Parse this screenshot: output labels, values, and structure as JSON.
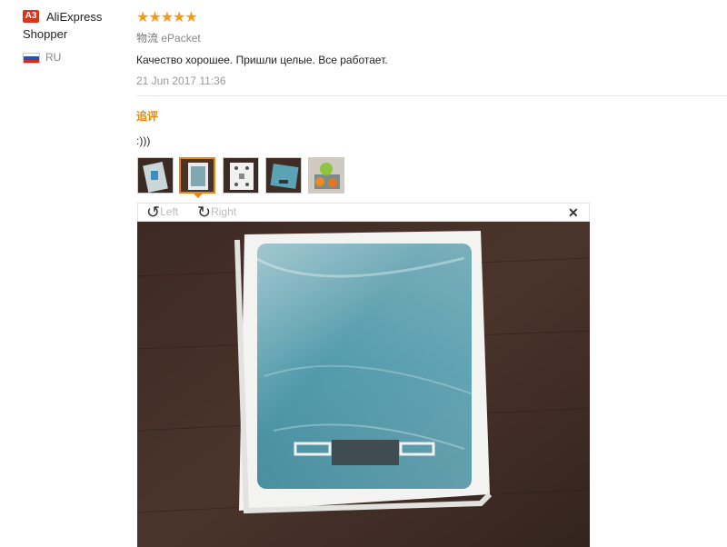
{
  "reviewer": {
    "badge": "A3",
    "name": "AliExpress Shopper",
    "country_code": "RU",
    "flag_colors": [
      "#ffffff",
      "#2d4fa8",
      "#d52b1e"
    ]
  },
  "feedback": {
    "stars": "★★★★★",
    "rating": 5,
    "logistics_label": "物流",
    "logistics_value": "ePacket",
    "text": "Качество хорошее. Пришли целые. Все работает.",
    "date": "21 Jun 2017 11:36"
  },
  "additional_feedback": {
    "heading": "追评",
    "text": ":)))"
  },
  "thumbnails": [
    {
      "name": "thumbnail-1",
      "active": false
    },
    {
      "name": "thumbnail-2",
      "active": true
    },
    {
      "name": "thumbnail-3",
      "active": false
    },
    {
      "name": "thumbnail-4",
      "active": false
    },
    {
      "name": "thumbnail-5",
      "active": false
    }
  ],
  "viewer": {
    "rotate_left_label": "Left",
    "rotate_right_label": "Right",
    "rotate_left_icon": "rotate-left-icon",
    "rotate_right_icon": "rotate-right-icon",
    "close_icon": "close-icon",
    "close_glyph": "✕"
  },
  "colors": {
    "accent_orange": "#e8860d",
    "star": "#f59a14",
    "badge_red": "#d9351c",
    "scale_teal": "#4a9aab"
  }
}
